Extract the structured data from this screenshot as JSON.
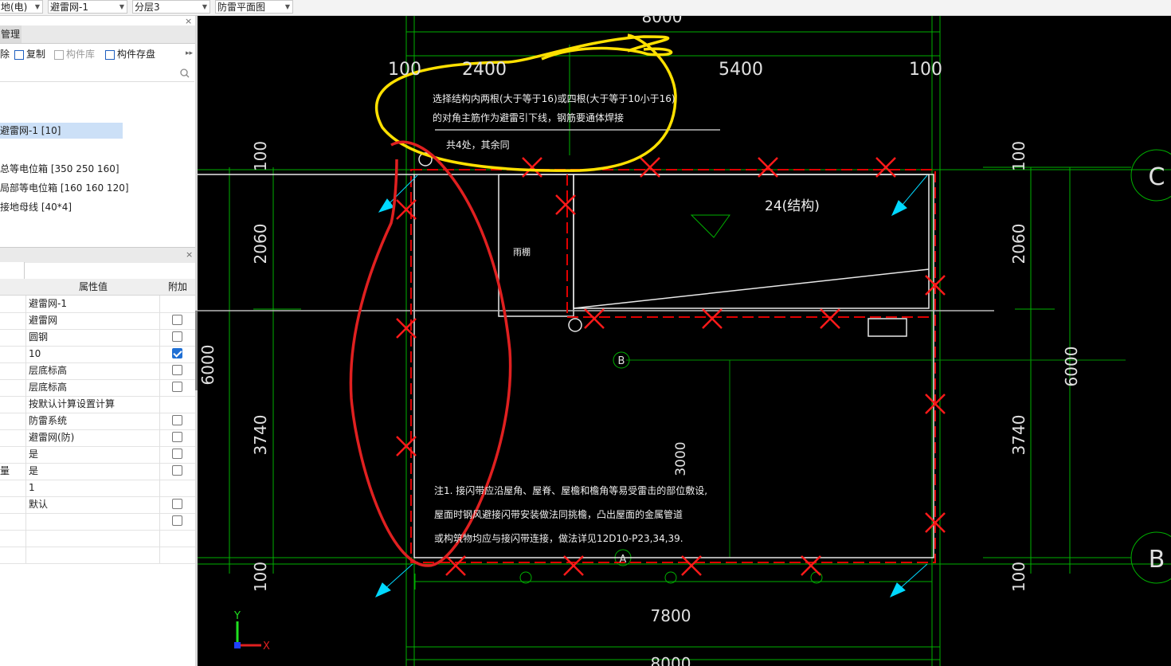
{
  "toolbar": {
    "dropdowns": [
      "地(电)",
      "避雷网-1",
      "分层3",
      "防雷平面图"
    ]
  },
  "left_panel": {
    "tab_label": "管理",
    "actions": {
      "delete_label": "除",
      "copy_label": "复制",
      "library_label": "构件库",
      "save_label": "构件存盘"
    },
    "tree": [
      {
        "label": "避雷网-1 [10]",
        "selected": true
      },
      {
        "label": "总等电位箱 [350 250 160]",
        "selected": false
      },
      {
        "label": "局部等电位箱 [160 160 120]",
        "selected": false
      },
      {
        "label": "接地母线 [40*4]",
        "selected": false
      }
    ],
    "properties": {
      "col_value": "属性值",
      "col_extra": "附加",
      "rows": [
        {
          "name": "",
          "value": "避雷网-1",
          "checkbox": null
        },
        {
          "name": "",
          "value": "避雷网",
          "checkbox": false
        },
        {
          "name": "",
          "value": "圆钢",
          "checkbox": false
        },
        {
          "name": "",
          "value": "10",
          "checkbox": true
        },
        {
          "name": "",
          "value": "层底标高",
          "checkbox": false
        },
        {
          "name": "",
          "value": "层底标高",
          "checkbox": false
        },
        {
          "name": "",
          "value": "按默认计算设置计算",
          "checkbox": null
        },
        {
          "name": "",
          "value": "防雷系统",
          "checkbox": false
        },
        {
          "name": "",
          "value": "避雷网(防)",
          "checkbox": false
        },
        {
          "name": "",
          "value": "是",
          "checkbox": false
        },
        {
          "name": "量",
          "value": "是",
          "checkbox": false
        },
        {
          "name": "",
          "value": "1",
          "checkbox": null
        },
        {
          "name": "",
          "value": "默认",
          "checkbox": false
        },
        {
          "name": "",
          "value": "",
          "checkbox": false
        },
        {
          "name": "",
          "value": "",
          "checkbox": null
        },
        {
          "name": "",
          "value": "",
          "checkbox": null
        }
      ]
    }
  },
  "drawing": {
    "dims_top": {
      "overall": "8000",
      "d1": "100",
      "d2": "2400",
      "d3": "5400",
      "d4": "100"
    },
    "dims_bottom": {
      "overall": "8000",
      "main": "7800"
    },
    "dims_left": {
      "d1": "100",
      "d2": "2060",
      "overall": "6000",
      "d3": "3740",
      "d4": "100"
    },
    "dims_right": {
      "d1": "100",
      "d2": "2060",
      "overall": "6000",
      "d3": "3740",
      "d4": "100"
    },
    "interior_dim": "3000",
    "axis_labels": {
      "c": "C",
      "b": "B",
      "b_small": "B",
      "a_small": "A"
    },
    "note_top": {
      "line1": "选择结构内两根(大于等于16)或四根(大于等于10小于16)",
      "line2": "的对角主筋作为避雷引下线，钢筋要通体焊接",
      "line3": "共4处，其余同"
    },
    "canopy_label": "雨棚",
    "slab_label": "24(结构)",
    "note_bottom": {
      "line1": "注1.  接闪带应沿屋角、屋脊、屋檐和檐角等易受雷击的部位敷设,",
      "line2": "屋面时钢风避接闪带安装做法同挑檐，凸出屋面的金属管道",
      "line3": "或构筑物均应与接闪带连接，做法详见12D10-P23,34,39."
    },
    "ucs": {
      "y": "Y",
      "x": "X"
    },
    "colors": {
      "background": "#000000",
      "dimension": "#00c800",
      "wall": "#ffffff",
      "mark": "#ff2020",
      "highlight_yellow": "#ffe000",
      "arrow": "#00d8ff"
    }
  }
}
